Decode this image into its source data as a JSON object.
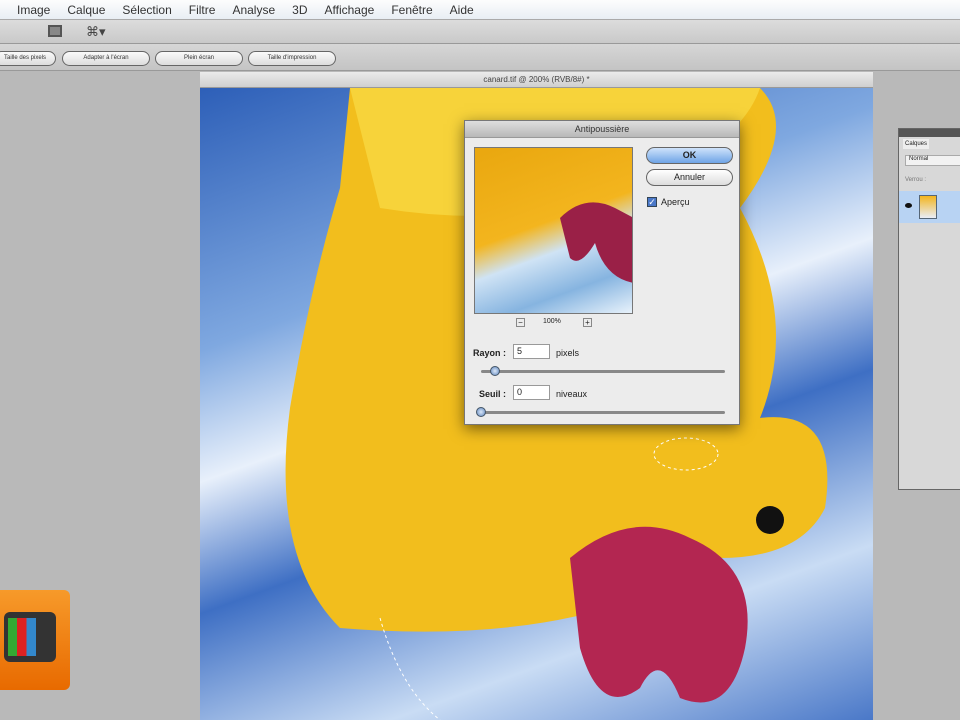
{
  "menu": [
    "Image",
    "Calque",
    "Sélection",
    "Filtre",
    "Analyse",
    "3D",
    "Affichage",
    "Fenêtre",
    "Aide"
  ],
  "buttons": [
    "Taille des pixels",
    "Adapter à l'écran",
    "Plein écran",
    "Taille d'impression"
  ],
  "document_title": "canard.tif @ 200% (RVB/8#) *",
  "dialog": {
    "title": "Antipoussière",
    "ok": "OK",
    "cancel": "Annuler",
    "preview_label": "Aperçu",
    "preview_checked": true,
    "zoom": "100%",
    "zoom_out": "−",
    "zoom_in": "+",
    "radius_label": "Rayon :",
    "radius_value": "5",
    "radius_unit": "pixels",
    "threshold_label": "Seuil :",
    "threshold_value": "0",
    "threshold_unit": "niveaux"
  },
  "layers": {
    "tab": "Calques",
    "blend": "Normal",
    "lock": "Verrou :"
  }
}
